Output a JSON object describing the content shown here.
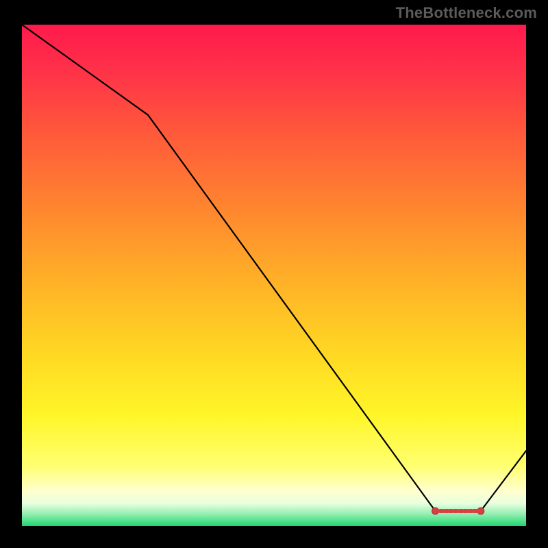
{
  "watermark": "TheBottleneck.com",
  "chart_data": {
    "type": "line",
    "x": [
      0,
      25,
      82,
      91,
      100
    ],
    "values": [
      100,
      82,
      3,
      3,
      15
    ],
    "title": "",
    "xlabel": "",
    "ylabel": "",
    "xlim": [
      0,
      100
    ],
    "ylim": [
      0,
      100
    ],
    "flat_region": {
      "x_start": 82,
      "x_end": 91,
      "y": 3
    },
    "gradient_stops": [
      {
        "offset": 0.0,
        "color": "#ff1a4b"
      },
      {
        "offset": 0.08,
        "color": "#ff2e4a"
      },
      {
        "offset": 0.22,
        "color": "#ff5a3a"
      },
      {
        "offset": 0.38,
        "color": "#ff8a2e"
      },
      {
        "offset": 0.52,
        "color": "#ffb327"
      },
      {
        "offset": 0.66,
        "color": "#ffd923"
      },
      {
        "offset": 0.78,
        "color": "#fff629"
      },
      {
        "offset": 0.88,
        "color": "#ffff70"
      },
      {
        "offset": 0.93,
        "color": "#ffffce"
      },
      {
        "offset": 0.955,
        "color": "#e8ffde"
      },
      {
        "offset": 0.975,
        "color": "#98f0b4"
      },
      {
        "offset": 1.0,
        "color": "#1dd76e"
      }
    ]
  }
}
